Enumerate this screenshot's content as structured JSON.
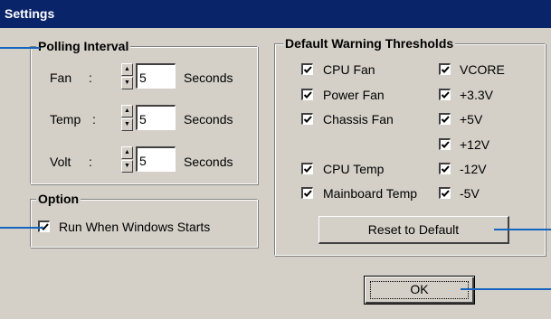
{
  "window": {
    "title": "Settings"
  },
  "polling": {
    "legend": "Polling Interval",
    "rows": [
      {
        "label": "Fan",
        "colon": ":",
        "value": "5",
        "unit": "Seconds"
      },
      {
        "label": "Temp",
        "colon": ":",
        "value": "5",
        "unit": "Seconds"
      },
      {
        "label": "Volt",
        "colon": ":",
        "value": "5",
        "unit": "Seconds"
      }
    ]
  },
  "option": {
    "legend": "Option",
    "run_when_windows_starts": {
      "label": "Run When Windows Starts",
      "checked": true
    }
  },
  "thresholds": {
    "legend": "Default Warning Thresholds",
    "left": [
      {
        "label": "CPU Fan",
        "checked": true
      },
      {
        "label": "Power Fan",
        "checked": true
      },
      {
        "label": "Chassis Fan",
        "checked": true
      },
      {
        "label": "CPU Temp",
        "checked": true
      },
      {
        "label": "Mainboard Temp",
        "checked": true
      }
    ],
    "right": [
      {
        "label": "VCORE",
        "checked": true
      },
      {
        "label": "+3.3V",
        "checked": true
      },
      {
        "label": "+5V",
        "checked": true
      },
      {
        "label": "+12V",
        "checked": true
      },
      {
        "label": "-12V",
        "checked": true
      },
      {
        "label": "-5V",
        "checked": true
      }
    ],
    "reset_label": "Reset to Default"
  },
  "ok_label": "OK",
  "colors": {
    "titlebar": "#0a246a",
    "face": "#d4d0c8",
    "callout": "#1565c0"
  }
}
